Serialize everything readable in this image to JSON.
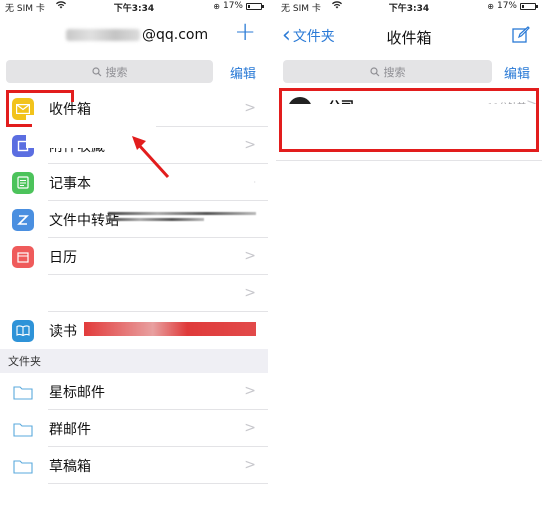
{
  "status": {
    "carrier": "无 SIM 卡",
    "time": "下午3:34",
    "battery": "17%",
    "battery_level": 0.17
  },
  "left": {
    "account_suffix": "@qq.com",
    "search_placeholder": "搜索",
    "edit": "编辑",
    "items": [
      {
        "label": "收件箱",
        "color": "#f2c31b"
      },
      {
        "label": "附件收藏",
        "color": "#5b6ee1"
      },
      {
        "label": "记事本",
        "color": "#4cc35b"
      },
      {
        "label": "文件中转站",
        "color": "#4a8fe0"
      },
      {
        "label": "日历",
        "color": "#ef5b5b"
      },
      {
        "label": "",
        "color": ""
      },
      {
        "label": "读书",
        "color": "#2e93d8"
      }
    ],
    "folder_section": "文件夹",
    "folders": [
      {
        "label": "星标邮件"
      },
      {
        "label": "群邮件"
      },
      {
        "label": "草稿箱"
      }
    ]
  },
  "right": {
    "back": "文件夹",
    "title": "收件箱",
    "search_placeholder": "搜索",
    "edit": "编辑",
    "mail": {
      "sender": "公司",
      "time": "11分钟前"
    }
  },
  "colors": {
    "accent": "#2a7ad6",
    "highlight": "#e21d1d"
  }
}
